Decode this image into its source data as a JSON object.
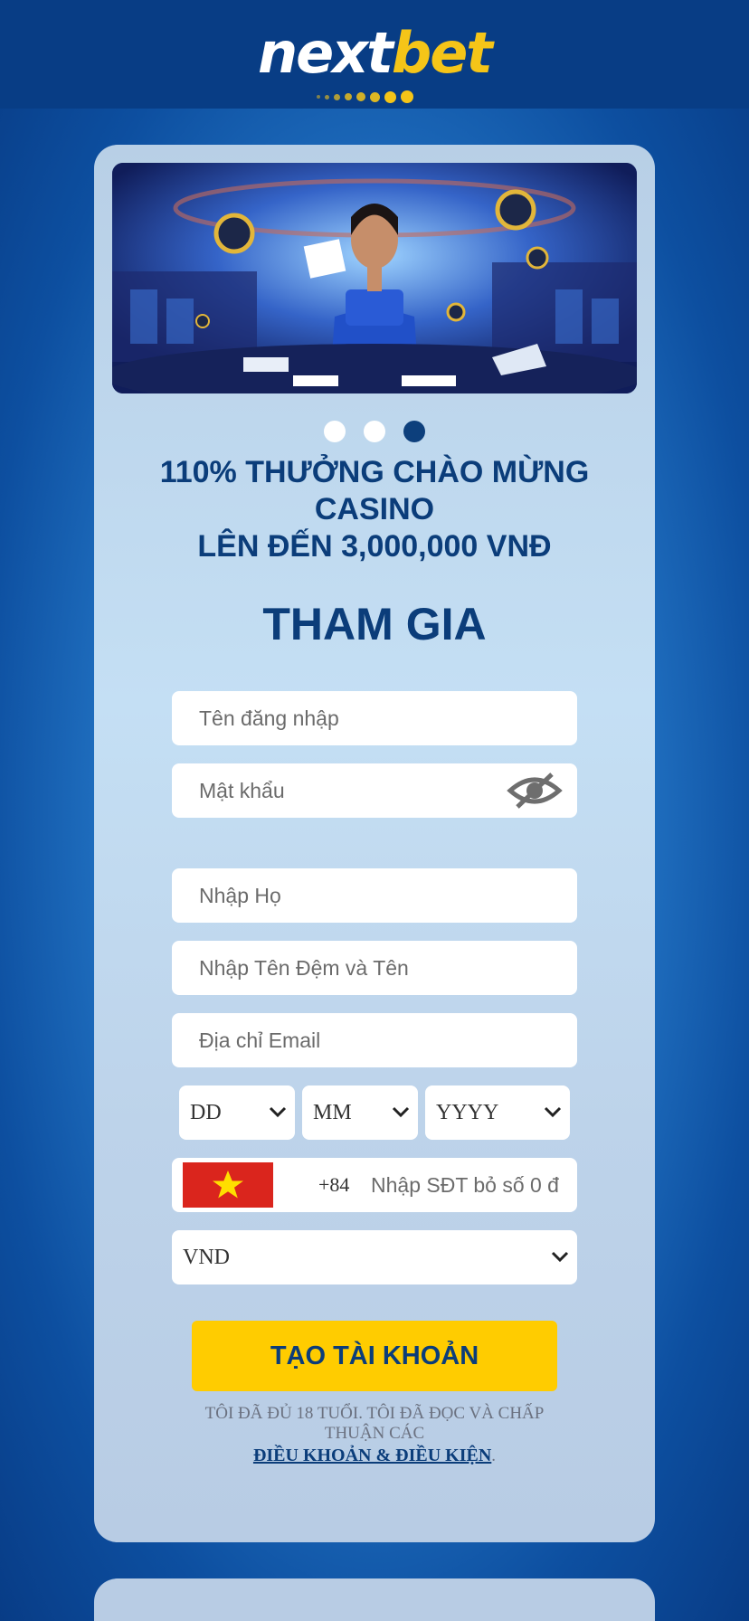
{
  "logo": {
    "part1": "next",
    "part2": "bet"
  },
  "banner": {
    "alt_icon": "casino-dealer-image"
  },
  "carousel": {
    "count": 3,
    "active": 3
  },
  "promo": {
    "line1": "110% THƯỞNG CHÀO MỪNG CASINO",
    "line2": "LÊN ĐẾN 3,000,000 VNĐ"
  },
  "form": {
    "title": "THAM GIA",
    "username_placeholder": "Tên đăng nhập",
    "password_placeholder": "Mật khẩu",
    "lastname_placeholder": "Nhập Họ",
    "firstname_placeholder": "Nhập Tên Đệm và Tên",
    "email_placeholder": "Địa chỉ Email",
    "dob": {
      "day": "DD",
      "month": "MM",
      "year": "YYYY"
    },
    "phone": {
      "country_code": "+84",
      "placeholder": "Nhập SĐT bỏ số 0 đ"
    },
    "currency": "VND",
    "submit_label": "TẠO TÀI KHOẢN",
    "terms_text": "TÔI ĐÃ ĐỦ 18 TUỔI. TÔI ĐÃ ĐỌC VÀ CHẤP THUẬN CÁC",
    "terms_link": "ĐIỀU KHOẢN & ĐIỀU KIỆN",
    "terms_end": "."
  },
  "colors": {
    "brand_blue": "#0b3d7a",
    "brand_yellow": "#ffcc00",
    "header": "#083d85"
  }
}
